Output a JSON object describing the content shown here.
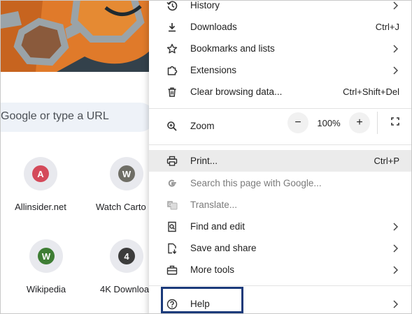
{
  "newtab": {
    "search_placeholder": "Google or type a URL",
    "shortcuts": [
      {
        "label": "Allinsider.net",
        "letter": "A",
        "color": "#d44a5a"
      },
      {
        "label": "Watch Carto",
        "letter": "W",
        "color": "#6f6e66"
      },
      {
        "label": "Wikipedia",
        "letter": "W",
        "color": "#3e7d34"
      },
      {
        "label": "4K Downloa",
        "letter": "4",
        "color": "#3c3c3c"
      }
    ]
  },
  "menu": {
    "history": {
      "label": "History",
      "icon": "history-icon"
    },
    "downloads": {
      "label": "Downloads",
      "shortcut": "Ctrl+J",
      "icon": "download-icon"
    },
    "bookmarks": {
      "label": "Bookmarks and lists",
      "icon": "star-icon"
    },
    "extensions": {
      "label": "Extensions",
      "icon": "puzzle-icon"
    },
    "clear_data": {
      "label": "Clear browsing data...",
      "shortcut": "Ctrl+Shift+Del",
      "icon": "trash-icon"
    },
    "zoom": {
      "label": "Zoom",
      "value": "100%",
      "minus": "−",
      "plus": "+",
      "icon": "zoom-icon"
    },
    "print": {
      "label": "Print...",
      "shortcut": "Ctrl+P",
      "icon": "printer-icon"
    },
    "search_page": {
      "label": "Search this page with Google...",
      "icon": "google-g-icon"
    },
    "translate": {
      "label": "Translate...",
      "icon": "translate-icon"
    },
    "find_edit": {
      "label": "Find and edit",
      "icon": "find-icon"
    },
    "save_share": {
      "label": "Save and share",
      "icon": "save-share-icon"
    },
    "more_tools": {
      "label": "More tools",
      "icon": "toolbox-icon"
    },
    "help": {
      "label": "Help",
      "icon": "help-icon"
    }
  },
  "colors": {
    "highlight_box": "#1b3a7a",
    "hover_row": "#ebebeb",
    "disabled_text": "#7b7b7b"
  }
}
